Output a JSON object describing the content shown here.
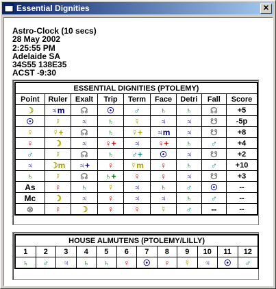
{
  "window": {
    "title": "Essential Dignities",
    "close_glyph": "✕"
  },
  "info_lines": [
    "Astro-Clock (10 secs)",
    "28 May 2002",
    "2:25:55 PM",
    "Adelaide SA",
    "34S55 138E35",
    "ACST -9:30"
  ],
  "dignities": {
    "title": "ESSENTIAL DIGNITIES (PTOLEMY)",
    "headers": [
      "Point",
      "Ruler",
      "Exalt",
      "Trip",
      "Term",
      "Face",
      "Detri",
      "Fall",
      "Score"
    ],
    "rows": [
      [
        [
          "☽",
          "#a0a000"
        ],
        [
          "♃m",
          "#00008b"
        ],
        [
          "☊",
          "#808080"
        ],
        [
          "☉",
          "#00008b"
        ],
        [
          "♂",
          "#008080"
        ],
        [
          "♄",
          "#006400"
        ],
        [
          "♄",
          "#006400"
        ],
        [
          "☊",
          "#808080"
        ],
        "+5"
      ],
      [
        [
          "☉",
          "#00008b"
        ],
        [
          "☿",
          "#a0a000"
        ],
        [
          "♃",
          "#00008b"
        ],
        [
          "♄",
          "#006400"
        ],
        [
          "☿",
          "#a0a000"
        ],
        [
          "♃",
          "#00008b"
        ],
        [
          "♃",
          "#00008b"
        ],
        [
          "☋",
          "#808080"
        ],
        "-5p"
      ],
      [
        [
          "☿",
          "#a0a000"
        ],
        [
          "☿+",
          "#a0a000"
        ],
        [
          "☊",
          "#808080"
        ],
        [
          "♄",
          "#006400"
        ],
        [
          "☿+",
          "#a0a000"
        ],
        [
          "♃m",
          "#00008b"
        ],
        [
          "♃",
          "#00008b"
        ],
        [
          "☋",
          "#808080"
        ],
        "+8"
      ],
      [
        [
          "♀",
          "#c00000"
        ],
        [
          "☽",
          "#a0a000"
        ],
        [
          "♃",
          "#00008b"
        ],
        [
          "♀+",
          "#c00000"
        ],
        [
          "♃",
          "#00008b"
        ],
        [
          "♀+",
          "#c00000"
        ],
        [
          "♄",
          "#006400"
        ],
        [
          "♂",
          "#008080"
        ],
        "+4"
      ],
      [
        [
          "♂",
          "#008080"
        ],
        [
          "☿",
          "#a0a000"
        ],
        [
          "☊",
          "#808080"
        ],
        [
          "♄",
          "#006400"
        ],
        [
          "♂+",
          "#008080"
        ],
        [
          "☉",
          "#00008b"
        ],
        [
          "♃",
          "#00008b"
        ],
        [
          "☋",
          "#808080"
        ],
        "+2"
      ],
      [
        [
          "♃",
          "#00008b"
        ],
        [
          "☽m",
          "#a0a000"
        ],
        [
          "♃+",
          "#00008b"
        ],
        [
          "♀",
          "#c00000"
        ],
        [
          "☿m",
          "#a0a000"
        ],
        [
          "♀",
          "#c00000"
        ],
        [
          "♄",
          "#006400"
        ],
        [
          "♂",
          "#008080"
        ],
        "+10"
      ],
      [
        [
          "♄",
          "#006400"
        ],
        [
          "☿",
          "#a0a000"
        ],
        [
          "☊",
          "#808080"
        ],
        [
          "♄+",
          "#006400"
        ],
        [
          "♀",
          "#c00000"
        ],
        [
          "♀",
          "#c00000"
        ],
        [
          "♃",
          "#00008b"
        ],
        [
          "☋",
          "#808080"
        ],
        "+3"
      ],
      [
        [
          "As",
          "#000000"
        ],
        [
          "♀",
          "#c00000"
        ],
        [
          "♄",
          "#006400"
        ],
        [
          "☿",
          "#a0a000"
        ],
        [
          "♃",
          "#00008b"
        ],
        [
          "♄",
          "#006400"
        ],
        [
          "♂",
          "#008080"
        ],
        [
          "☉",
          "#00008b"
        ],
        "--"
      ],
      [
        [
          "Mc",
          "#000000"
        ],
        [
          "☽",
          "#a0a000"
        ],
        [
          "♃",
          "#00008b"
        ],
        [
          "♀",
          "#c00000"
        ],
        [
          "♃",
          "#00008b"
        ],
        [
          "♃",
          "#00008b"
        ],
        [
          "♄",
          "#006400"
        ],
        [
          "♂",
          "#008080"
        ],
        "--"
      ],
      [
        [
          "⊗",
          "#808080"
        ],
        [
          "♀",
          "#c00000"
        ],
        [
          "☽",
          "#a0a000"
        ],
        [
          "♀",
          "#c00000"
        ],
        [
          "♀",
          "#c00000"
        ],
        [
          "☿",
          "#a0a000"
        ],
        [
          "♂",
          "#008080"
        ],
        [
          "--",
          "#000000"
        ],
        "--"
      ]
    ]
  },
  "almutens": {
    "title": "HOUSE ALMUTENS (PTOLEMY/LILLY)",
    "houses": [
      "1",
      "2",
      "3",
      "4",
      "5",
      "6",
      "7",
      "8",
      "9",
      "10",
      "11",
      "12"
    ],
    "rulers": [
      [
        "♄",
        "#006400"
      ],
      [
        "♂",
        "#008080"
      ],
      [
        "♃",
        "#00008b"
      ],
      [
        "♄",
        "#006400"
      ],
      [
        "♄",
        "#006400"
      ],
      [
        "♀",
        "#c00000"
      ],
      [
        "☉",
        "#00008b"
      ],
      [
        "♀",
        "#c00000"
      ],
      [
        "☿",
        "#a0a000"
      ],
      [
        "♃",
        "#00008b"
      ],
      [
        "☉",
        "#00008b"
      ],
      [
        "♂",
        "#008080"
      ]
    ]
  }
}
